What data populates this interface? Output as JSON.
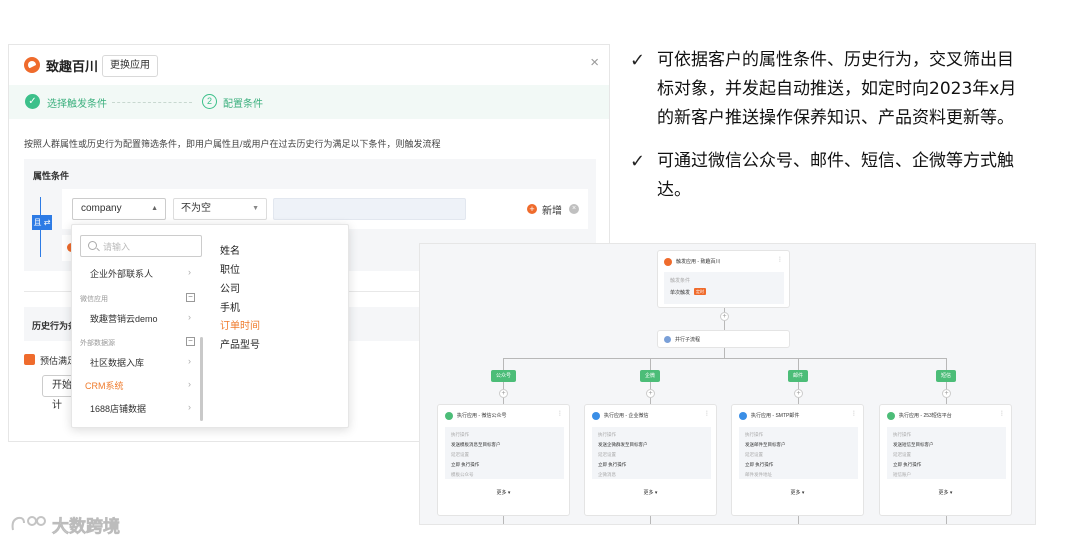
{
  "dialog": {
    "app_title": "致趣百川",
    "switch_button": "更换应用",
    "close_glyph": "×",
    "steps": [
      {
        "index": "✓",
        "label": "选择触发条件"
      },
      {
        "index": "2",
        "label": "配置条件"
      }
    ],
    "description": "按照人群属性或历史行为配置筛选条件，即用户属性且/或用户在过去历史行为满足以下条件，则触发流程",
    "attr_title": "属性条件",
    "and_tag": "且 ⇄",
    "condition": {
      "field": "company",
      "operator": "不为空",
      "value": "",
      "add_label": "新增"
    },
    "history_title": "历史行为条件",
    "history_title_visible": "历史行为条",
    "estimate_label": "预估满足",
    "start_button": "开始计"
  },
  "dropdown": {
    "search_placeholder": "请输入",
    "items": [
      {
        "type": "item",
        "label": "企业外部联系人",
        "active": false
      },
      {
        "type": "group",
        "label": "微信应用"
      },
      {
        "type": "item",
        "label": "致趣营销云demo",
        "active": false
      },
      {
        "type": "group",
        "label": "外部数据源"
      },
      {
        "type": "item",
        "label": "社区数据入库",
        "active": false
      },
      {
        "type": "item",
        "label": "CRM系统",
        "active": true
      },
      {
        "type": "item",
        "label": "1688店铺数据",
        "active": false
      }
    ],
    "fields": [
      "姓名",
      "职位",
      "公司",
      "手机",
      "订单时间",
      "产品型号"
    ],
    "active_field": "订单时间"
  },
  "bullets": [
    {
      "lines": [
        "可依据客户的属性条件、历史行为，交叉筛出目",
        "标对象，并发起自动推送，如定时向2023年x月",
        "的新客户推送操作保养知识、产品资料更新等。"
      ]
    },
    {
      "lines": [
        "可通过微信公众号、邮件、短信、企微等方式触",
        "达。"
      ]
    }
  ],
  "flow": {
    "trigger": {
      "title": "触发应用 - 致趣百川",
      "sub": "触发条件",
      "value": "单次触发",
      "badge": "定时"
    },
    "parallel_label": "并行子流程",
    "channels": [
      "公众号",
      "企微",
      "邮件",
      "短信"
    ],
    "actions": [
      {
        "title": "执行应用 - 微信公众号",
        "icon_color": "#4cbd78",
        "lines": [
          "执行操作",
          "发送模板消息至目标客户",
          "延迟设置",
          "立即 执行操作",
          "模板公众号"
        ]
      },
      {
        "title": "执行应用 - 企业微信",
        "icon_color": "#3a8ee6",
        "lines": [
          "执行操作",
          "发送企微群发至目标客户",
          "延迟设置",
          "立即 执行操作",
          "企微消息"
        ]
      },
      {
        "title": "执行应用 - SMTP邮件",
        "icon_color": "#3a8ee6",
        "lines": [
          "执行操作",
          "发送邮件至目标客户",
          "延迟设置",
          "立即 执行操作",
          "邮件发件地址"
        ]
      },
      {
        "title": "执行应用 - 253短信平台",
        "icon_color": "#4cbd78",
        "lines": [
          "执行操作",
          "发送短信至目标客户",
          "延迟设置",
          "立即 执行操作",
          "短信账户"
        ]
      }
    ],
    "more_label": "更多 ▾"
  },
  "watermark": "大数跨境",
  "colors": {
    "brand": "#ef6b2c",
    "success": "#3cc08a",
    "and_blue": "#2d7be5"
  }
}
